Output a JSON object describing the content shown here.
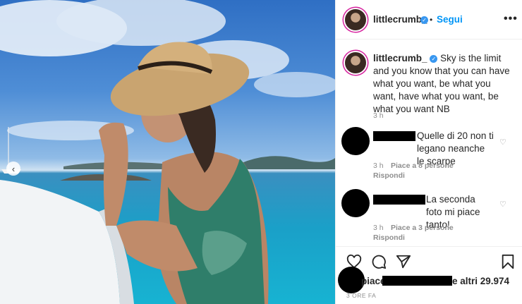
{
  "post": {
    "username": "littlecrumb_",
    "follow_label": "Segui",
    "dot": "•",
    "more_label": "•••",
    "caption": "Sky is the limit and you know that you can have what you want, be what you want, have what you want, be what you want NB",
    "caption_time": "3 h"
  },
  "comments": [
    {
      "text": "Quelle di 20 non ti legano neanche le scarpe",
      "time": "3 h",
      "likes": "Piace a 8 persone",
      "reply": "Rispondi"
    },
    {
      "text": "La seconda foto mi piace tanto!",
      "time": "3 h",
      "likes": "Piace a 3 persone",
      "reply": "Rispondi"
    }
  ],
  "footer": {
    "likes_prefix": "piace",
    "likes_suffix": "e altri 29.974",
    "posted_ago": "3 ORE FA"
  },
  "icons": {
    "carousel_prev": "‹",
    "verified": "✓",
    "comment_heart": "♡"
  },
  "colors": {
    "accent": "#0095f6",
    "verified": "#3897f0"
  }
}
